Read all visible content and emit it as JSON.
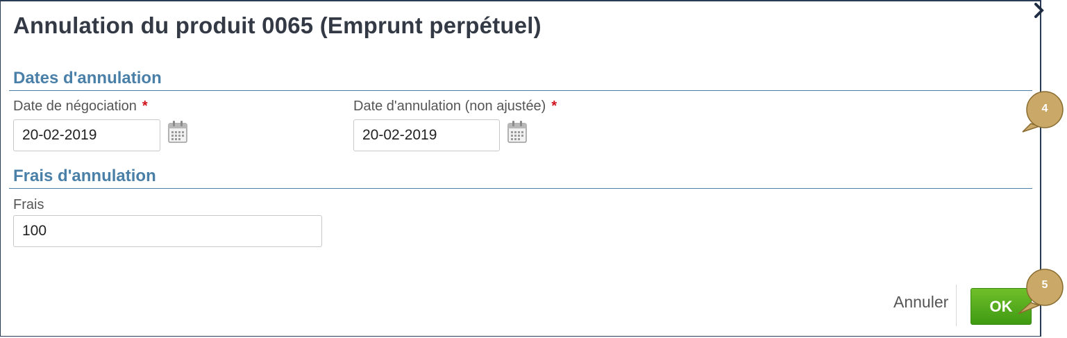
{
  "dialog": {
    "title": "Annulation du produit 0065 (Emprunt perpétuel)"
  },
  "sections": {
    "dates": {
      "title": "Dates d'annulation",
      "negotiation_date": {
        "label": "Date de négociation",
        "required_marker": "*",
        "value": "20-02-2019"
      },
      "cancellation_date": {
        "label": "Date d'annulation (non ajustée)",
        "required_marker": "*",
        "value": "20-02-2019"
      }
    },
    "fees": {
      "title": "Frais d'annulation",
      "fee": {
        "label": "Frais",
        "value": "100"
      }
    }
  },
  "footer": {
    "cancel_label": "Annuler",
    "ok_label": "OK"
  },
  "callouts": {
    "first": "4",
    "second": "5"
  },
  "colors": {
    "section_title": "#4a80a8",
    "ok_button": "#4fa81a",
    "required": "#d0101a",
    "callout": "#c9a868"
  },
  "icons": {
    "close": "close-icon",
    "calendar": "calendar-icon"
  }
}
